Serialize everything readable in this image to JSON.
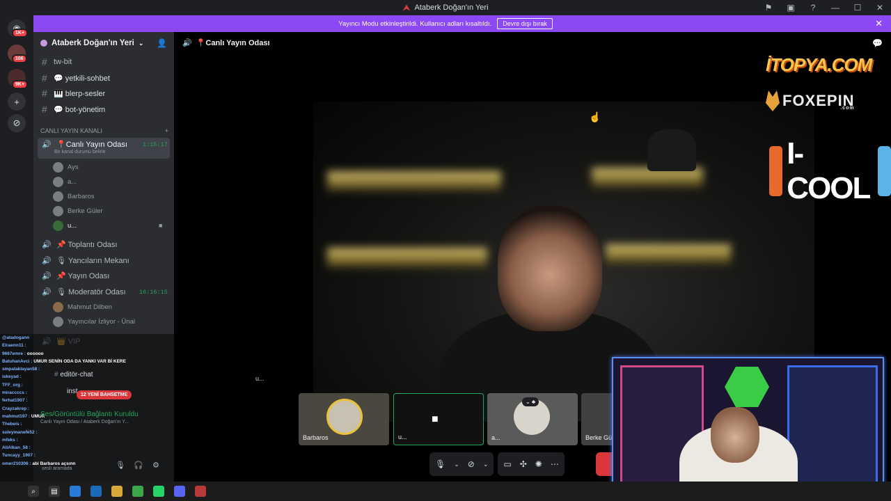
{
  "window": {
    "title": "Ataberk Doğan'ın Yeri"
  },
  "banner": {
    "message": "Yayıncı Modu etkinleştirildi. Kullanıcı adları kısaltıldı.",
    "button": "Devre dışı bırak"
  },
  "guilds": {
    "badges": [
      "1K+",
      "106",
      "9K+"
    ]
  },
  "server": {
    "name": "Ataberk Doğan'ın Yeri"
  },
  "channels": {
    "text": [
      "tw-bit",
      "💬 yetkili-sohbet",
      "🎹 blerp-sesler",
      "💬 bot-yönetim"
    ],
    "category": "CANLI YAYIN KANALI",
    "active_voice": {
      "name": "📍Canlı Yayın Odası",
      "status": "Bir kanal durumu belirle",
      "timer": "1:15:17",
      "users": [
        "Ays",
        "a...",
        "Barbaros",
        "Berke Güler",
        "u..."
      ]
    },
    "voice": [
      "📌 Toplantı Odası",
      "🎙 Yancıların Mekanı",
      "📌 Yayın Odası"
    ],
    "moderator": {
      "name": "🎙 Moderatör Odası",
      "timer": "16:16:15",
      "users": [
        "Mahmut Dilben",
        "Yayıncılar İzliyor - Ünal"
      ]
    },
    "vip": "👑 VIP",
    "editor_chat": "editör-chat",
    "insta": "inst..."
  },
  "voice_panel": {
    "status": "Ses/Görüntülü Bağlantı Kuruldu",
    "location": "Canlı Yayın Odası / Ataberk Doğan'ın Y...",
    "mention_pill": "12 YENİ BAHSETME",
    "searching": "sesli aramada"
  },
  "chat_overlay": [
    {
      "user": "@atadogann",
      "msg": ""
    },
    {
      "user": "Elraenn11 :",
      "msg": ""
    },
    {
      "user": "9667emre :",
      "msg": "oooooo"
    },
    {
      "user": "BatuhanAvci :",
      "msg": "UMUR SENİN ODA DA YANKI VAR Bİ KERE"
    },
    {
      "user": "smpataklayan58 :",
      "msg": ""
    },
    {
      "user": "iskeyad :",
      "msg": ""
    },
    {
      "user": "TFF_org :",
      "msg": ""
    },
    {
      "user": "miraccccs :",
      "msg": ""
    },
    {
      "user": "ferhat1907 :",
      "msg": ""
    },
    {
      "user": "Crayzakrep :",
      "msg": ""
    },
    {
      "user": "mahmut197 :",
      "msg": "UMUR"
    },
    {
      "user": "Thebeis :",
      "msg": ""
    },
    {
      "user": "suleymanefe52 :",
      "msg": ""
    },
    {
      "user": "mfeks :",
      "msg": ""
    },
    {
      "user": "AliAlkan_58 :",
      "msg": ""
    },
    {
      "user": "Tuncayy_1907 :",
      "msg": ""
    },
    {
      "user": "omer210306 :",
      "msg": "abi Barbaros açsınn"
    }
  ],
  "stage": {
    "room_title": "📍Canlı Yayın Odası",
    "main_name": "u...",
    "tiles": [
      "Barbaros",
      "u...",
      "a...",
      "Berke Gül"
    ]
  },
  "sponsors": {
    "logo1": "İTOPYA.COM",
    "logo2": "FOXEPIN",
    "logo2_sub": ".com",
    "logo3": "I-COOL"
  },
  "colors": {
    "accent": "#8c48f5",
    "danger": "#da373c",
    "online": "#23a55a"
  }
}
